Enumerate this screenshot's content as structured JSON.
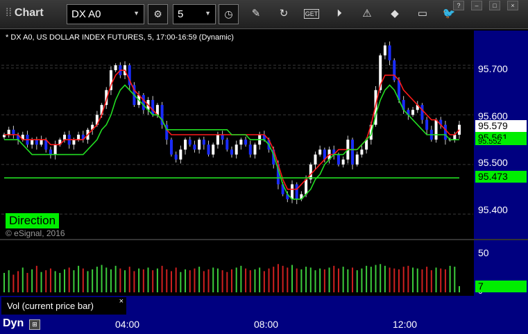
{
  "window": {
    "title": "Chart"
  },
  "toolbar": {
    "symbol": "DX A0",
    "interval": "5",
    "icons": [
      "settings-icon",
      "clock-icon",
      "pencil-icon",
      "refresh-icon",
      "get-icon",
      "play-icon",
      "alert-icon",
      "tag-icon",
      "comment-icon",
      "twitter-icon"
    ]
  },
  "window_controls": {
    "help": "?",
    "minimize": "–",
    "maximize": "□",
    "close": "×"
  },
  "chart": {
    "title": "* DX A0, US DOLLAR INDEX FUTURES, 5, 17:00-16:59 (Dynamic)",
    "price_labels": [
      "95.700",
      "95.600",
      "95.500",
      "95.400"
    ],
    "tags": [
      {
        "value": "95.579",
        "bg": "#ffffff",
        "fg": "#000000"
      },
      {
        "value": "95.561",
        "bg": "#00ee00",
        "fg": "#000000"
      },
      {
        "value": "95.552",
        "bg": "#00ee00",
        "fg": "#000000"
      },
      {
        "value": "95.473",
        "bg": "#00ee00",
        "fg": "#000000"
      }
    ],
    "direction_label": "Direction",
    "copyright": "© eSignal, 2016"
  },
  "volume": {
    "axis_labels": [
      "50",
      "0"
    ],
    "tag": {
      "value": "7",
      "bg": "#00ee00"
    }
  },
  "study_tab": {
    "label": "Vol (current price bar)",
    "close": "×"
  },
  "time_axis": {
    "mode": "Dyn",
    "labels": [
      "04:00",
      "08:00",
      "12:00"
    ]
  },
  "colors": {
    "up_candle": "#ffffff",
    "down_candle": "#1a2cff",
    "red_ma": "#ff1a1a",
    "green_ma": "#22dd22",
    "axis_bg": "#000080"
  },
  "chart_data": {
    "type": "candlestick",
    "title": "* DX A0, US DOLLAR INDEX FUTURES, 5, 17:00-16:59 (Dynamic)",
    "xlabel": "",
    "ylabel": "",
    "ylim": [
      95.35,
      95.77
    ],
    "x_ticks": [
      "04:00",
      "08:00",
      "12:00"
    ],
    "y_ticks": [
      95.4,
      95.5,
      95.6,
      95.7
    ],
    "closes": [
      95.56,
      95.57,
      95.56,
      95.55,
      95.56,
      95.54,
      95.55,
      95.54,
      95.55,
      95.53,
      95.52,
      95.54,
      95.55,
      95.56,
      95.54,
      95.55,
      95.56,
      95.55,
      95.57,
      95.58,
      95.6,
      95.62,
      95.65,
      95.69,
      95.7,
      95.68,
      95.7,
      95.66,
      95.62,
      95.64,
      95.61,
      95.63,
      95.6,
      95.62,
      95.58,
      95.55,
      95.52,
      95.51,
      95.53,
      95.55,
      95.54,
      95.53,
      95.55,
      95.54,
      95.52,
      95.54,
      95.56,
      95.55,
      95.53,
      95.52,
      95.54,
      95.55,
      95.54,
      95.52,
      95.54,
      95.56,
      95.55,
      95.53,
      95.5,
      95.46,
      95.44,
      95.43,
      95.46,
      95.43,
      95.44,
      95.47,
      95.5,
      95.52,
      95.53,
      95.51,
      95.53,
      95.52,
      95.5,
      95.51,
      95.55,
      95.5,
      95.52,
      95.53,
      95.55,
      95.58,
      95.65,
      95.72,
      95.74,
      95.71,
      95.67,
      95.63,
      95.61,
      95.6,
      95.61,
      95.62,
      95.59,
      95.57,
      95.55,
      95.59,
      95.58,
      95.55,
      95.55,
      95.56,
      95.58
    ],
    "volume": [
      22,
      25,
      20,
      24,
      28,
      22,
      26,
      30,
      23,
      25,
      27,
      24,
      22,
      26,
      28,
      25,
      30,
      27,
      24,
      26,
      29,
      31,
      28,
      26,
      30,
      27,
      25,
      29,
      24,
      27,
      26,
      28,
      25,
      27,
      30,
      26,
      24,
      28,
      23,
      26,
      25,
      27,
      29,
      24,
      26,
      28,
      27,
      25,
      23,
      26,
      28,
      30,
      27,
      25,
      26,
      28,
      24,
      27,
      29,
      32,
      30,
      28,
      31,
      27,
      26,
      29,
      28,
      25,
      27,
      26,
      28,
      30,
      27,
      29,
      26,
      28,
      25,
      27,
      30,
      29,
      31,
      32,
      30,
      28,
      27,
      26,
      29,
      30,
      28,
      27,
      26,
      29,
      25,
      28,
      27,
      26,
      30,
      29,
      7
    ],
    "series": [
      {
        "name": "",
        "color": "#ff1a1a",
        "values": [
          95.56,
          95.56,
          95.56,
          95.56,
          95.55,
          95.55,
          95.55,
          95.55,
          95.55,
          95.55,
          95.54,
          95.54,
          95.54,
          95.55,
          95.55,
          95.55,
          95.55,
          95.55,
          95.56,
          95.57,
          95.58,
          95.6,
          95.63,
          95.66,
          95.68,
          95.69,
          95.69,
          95.67,
          95.65,
          95.64,
          95.63,
          95.62,
          95.61,
          95.6,
          95.59,
          95.57,
          95.56,
          95.56,
          95.56,
          95.56,
          95.56,
          95.56,
          95.56,
          95.56,
          95.56,
          95.56,
          95.56,
          95.56,
          95.56,
          95.56,
          95.56,
          95.56,
          95.56,
          95.56,
          95.56,
          95.56,
          95.56,
          95.55,
          95.53,
          95.5,
          95.47,
          95.45,
          95.45,
          95.45,
          95.46,
          95.47,
          95.48,
          95.49,
          95.5,
          95.51,
          95.52,
          95.52,
          95.53,
          95.53,
          95.53,
          95.53,
          95.53,
          95.54,
          95.55,
          95.58,
          95.62,
          95.66,
          95.68,
          95.68,
          95.68,
          95.67,
          95.65,
          95.64,
          95.63,
          95.62,
          95.61,
          95.6,
          95.59,
          95.59,
          95.58,
          95.57,
          95.56,
          95.56,
          95.57
        ]
      },
      {
        "name": "",
        "color": "#22dd22",
        "values": [
          95.55,
          95.55,
          95.55,
          95.55,
          95.54,
          95.53,
          95.52,
          95.52,
          95.52,
          95.52,
          95.52,
          95.52,
          95.52,
          95.52,
          95.52,
          95.52,
          95.52,
          95.52,
          95.53,
          95.54,
          95.55,
          95.57,
          95.58,
          95.6,
          95.63,
          95.65,
          95.66,
          95.65,
          95.64,
          95.63,
          95.62,
          95.61,
          95.6,
          95.6,
          95.59,
          95.57,
          95.57,
          95.57,
          95.57,
          95.57,
          95.57,
          95.57,
          95.57,
          95.57,
          95.57,
          95.57,
          95.57,
          95.57,
          95.57,
          95.56,
          95.56,
          95.56,
          95.56,
          95.55,
          95.55,
          95.55,
          95.55,
          95.54,
          95.52,
          95.49,
          95.46,
          95.44,
          95.43,
          95.43,
          95.43,
          95.44,
          95.45,
          95.47,
          95.48,
          95.5,
          95.51,
          95.52,
          95.52,
          95.52,
          95.53,
          95.53,
          95.53,
          95.54,
          95.55,
          95.56,
          95.6,
          95.63,
          95.65,
          95.66,
          95.65,
          95.63,
          95.61,
          95.6,
          95.59,
          95.58,
          95.57,
          95.56,
          95.56,
          95.56,
          95.56,
          95.56,
          95.55,
          95.55,
          95.55
        ]
      },
      {
        "name": "",
        "color": "#22dd22",
        "values": [
          95.473,
          95.473,
          95.473,
          95.473,
          95.473,
          95.473,
          95.473,
          95.473,
          95.473,
          95.473,
          95.473,
          95.473,
          95.473,
          95.473,
          95.473,
          95.473,
          95.473,
          95.473,
          95.473,
          95.473,
          95.473,
          95.473,
          95.473,
          95.473,
          95.473,
          95.473,
          95.473,
          95.473,
          95.473,
          95.473,
          95.473,
          95.473,
          95.473,
          95.473,
          95.473,
          95.473,
          95.473,
          95.473,
          95.473,
          95.473,
          95.473,
          95.473,
          95.473,
          95.473,
          95.473,
          95.473,
          95.473,
          95.473,
          95.473,
          95.473,
          95.473,
          95.473,
          95.473,
          95.473,
          95.473,
          95.473,
          95.473,
          95.473,
          95.473,
          95.473,
          95.473,
          95.473,
          95.473,
          95.473,
          95.473,
          95.473,
          95.473,
          95.473,
          95.473,
          95.473,
          95.473,
          95.473,
          95.473,
          95.473,
          95.473,
          95.473,
          95.473,
          95.473,
          95.473,
          95.473,
          95.473,
          95.473,
          95.473,
          95.473,
          95.473,
          95.473,
          95.473,
          95.473,
          95.473,
          95.473,
          95.473,
          95.473,
          95.473,
          95.473,
          95.473,
          95.473,
          95.473,
          95.473,
          95.473
        ]
      }
    ],
    "grid": true,
    "legend": "none"
  }
}
